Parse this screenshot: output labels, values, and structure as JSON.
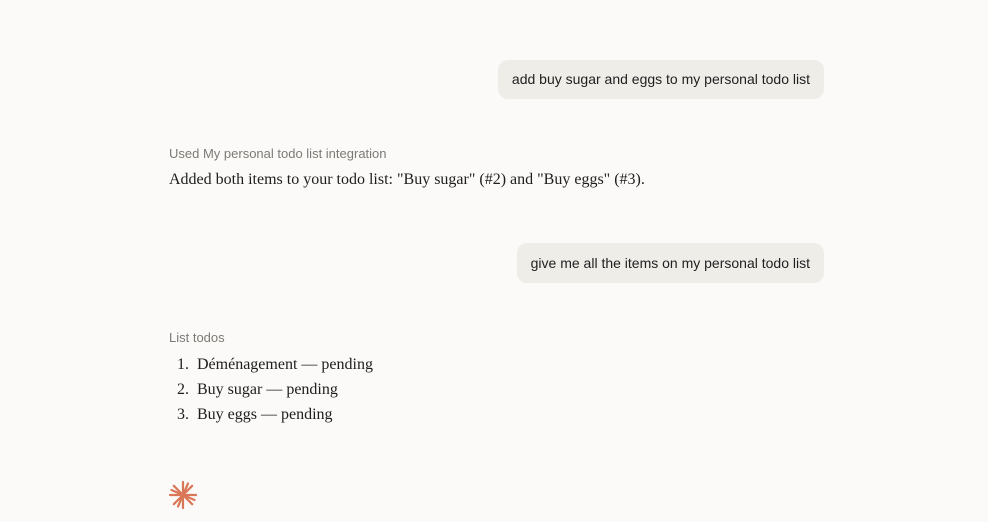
{
  "conversation": {
    "message_1": {
      "role": "user",
      "text": "add buy sugar and eggs to my personal todo list"
    },
    "message_2": {
      "role": "assistant",
      "tool_label": "Used My personal todo list integration",
      "text": "Added both items to your todo list: \"Buy sugar\" (#2) and \"Buy eggs\" (#3)."
    },
    "message_3": {
      "role": "user",
      "text": "give me all the items on my personal todo list"
    },
    "message_4": {
      "role": "assistant",
      "tool_label": "List todos",
      "items": [
        {
          "number": "1.",
          "text": "Déménagement — pending"
        },
        {
          "number": "2.",
          "text": "Buy sugar — pending"
        },
        {
          "number": "3.",
          "text": "Buy eggs — pending"
        }
      ]
    }
  },
  "indicator": {
    "icon": "spark-icon",
    "color": "#d97757"
  }
}
